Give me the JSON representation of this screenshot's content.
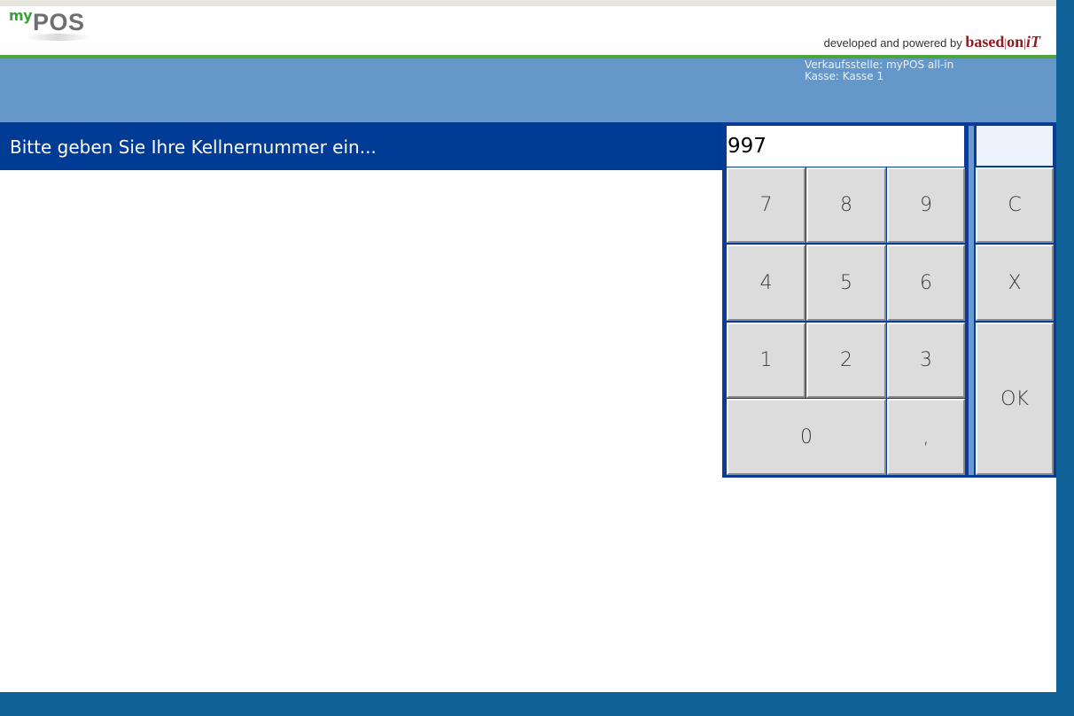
{
  "header": {
    "logo_prefix": "my",
    "logo_main": "POS",
    "powered_prefix": "developed and powered by",
    "brand_based": "based",
    "brand_on": "on",
    "brand_it": "iT"
  },
  "info": {
    "sales_point": "Verkaufsstelle: myPOS all-in",
    "register": "Kasse: Kasse 1"
  },
  "prompt": "Bitte geben Sie Ihre Kellnernummer ein...",
  "display_value": "997",
  "keypad": {
    "k7": "7",
    "k8": "8",
    "k9": "9",
    "clear": "C",
    "k4": "4",
    "k5": "5",
    "k6": "6",
    "cancel": "X",
    "k1": "1",
    "k2": "2",
    "k3": "3",
    "ok": "OK",
    "k0": "0",
    "comma": ","
  },
  "colors": {
    "header_bar": "#6697c9",
    "prompt_bar": "#003b95",
    "accent_green": "#4fa23a",
    "frame_blue": "#0f6198"
  }
}
